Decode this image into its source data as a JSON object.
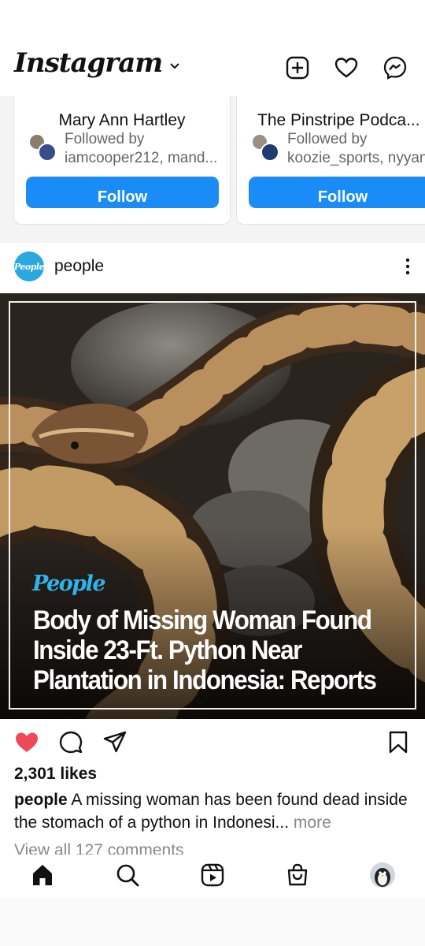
{
  "header": {
    "logo_text": "Instagram",
    "icons": [
      "add-post-icon",
      "heart-icon",
      "messenger-icon"
    ]
  },
  "suggestions": [
    {
      "name": "Mary Ann Hartley",
      "followed_by_label": "Followed by",
      "followed_by_users": "iamcooper212, mand...",
      "follow_label": "Follow"
    },
    {
      "name": "The Pinstripe Podca...",
      "followed_by_label": "Followed by",
      "followed_by_users": "koozie_sports, nyyan",
      "follow_label": "Follow"
    }
  ],
  "post": {
    "username": "people",
    "avatar_text": "People",
    "image": {
      "brand": "People",
      "headline_lines": [
        "Body of Missing Woman Found",
        "Inside 23-Ft. Python Near",
        "Plantation in Indonesia: Reports"
      ]
    },
    "liked": true,
    "likes": "2,301 likes",
    "caption_user": "people",
    "caption_text": "A missing woman has been found dead inside the stomach of a python in Indonesi...",
    "caption_more": "more",
    "view_comments": "View all 127 comments"
  },
  "colors": {
    "accent": "#1a8cf7",
    "like_red": "#ed4956",
    "people_blue": "#2fb3ea"
  },
  "bottom_nav": [
    "home-icon",
    "search-icon",
    "reels-icon",
    "shop-icon",
    "profile-avatar"
  ]
}
